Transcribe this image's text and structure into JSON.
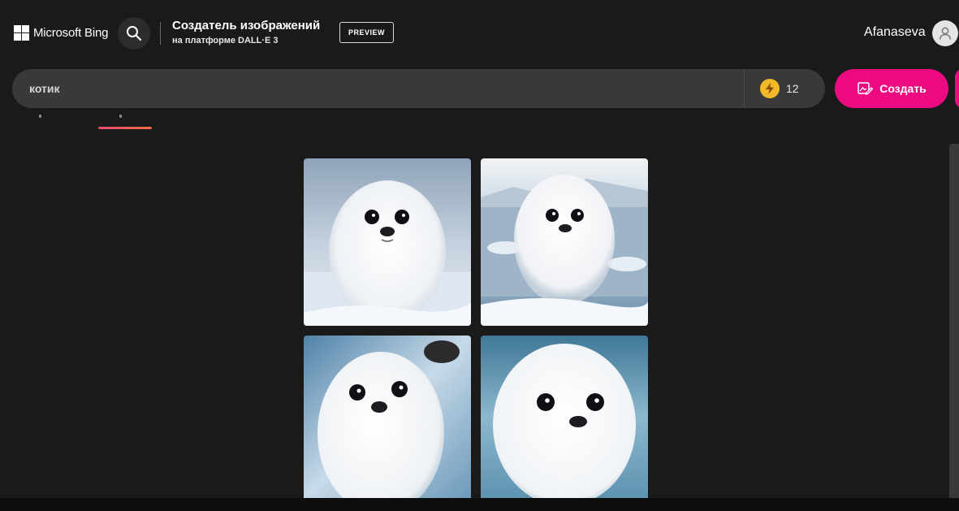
{
  "header": {
    "brand_label": "Microsoft Bing",
    "title": "Создатель изображений",
    "subtitle": "на платформе DALL·E 3",
    "preview_badge": "PREVIEW",
    "user_name": "Afanaseva"
  },
  "prompt": {
    "value": "котик",
    "boosts_count": "12",
    "create_label": "Создать"
  },
  "colors": {
    "background": "#1b1a1a",
    "accent_pink": "#ed0a81",
    "boost_yellow": "#f1b92a",
    "prompt_bg": "#3a3939"
  },
  "icons": {
    "search": "search-icon",
    "user": "user-icon",
    "boost": "lightning-icon",
    "create": "image-create-icon"
  },
  "images": [
    {
      "id": "image-1"
    },
    {
      "id": "image-2"
    },
    {
      "id": "image-3"
    },
    {
      "id": "image-4"
    }
  ]
}
